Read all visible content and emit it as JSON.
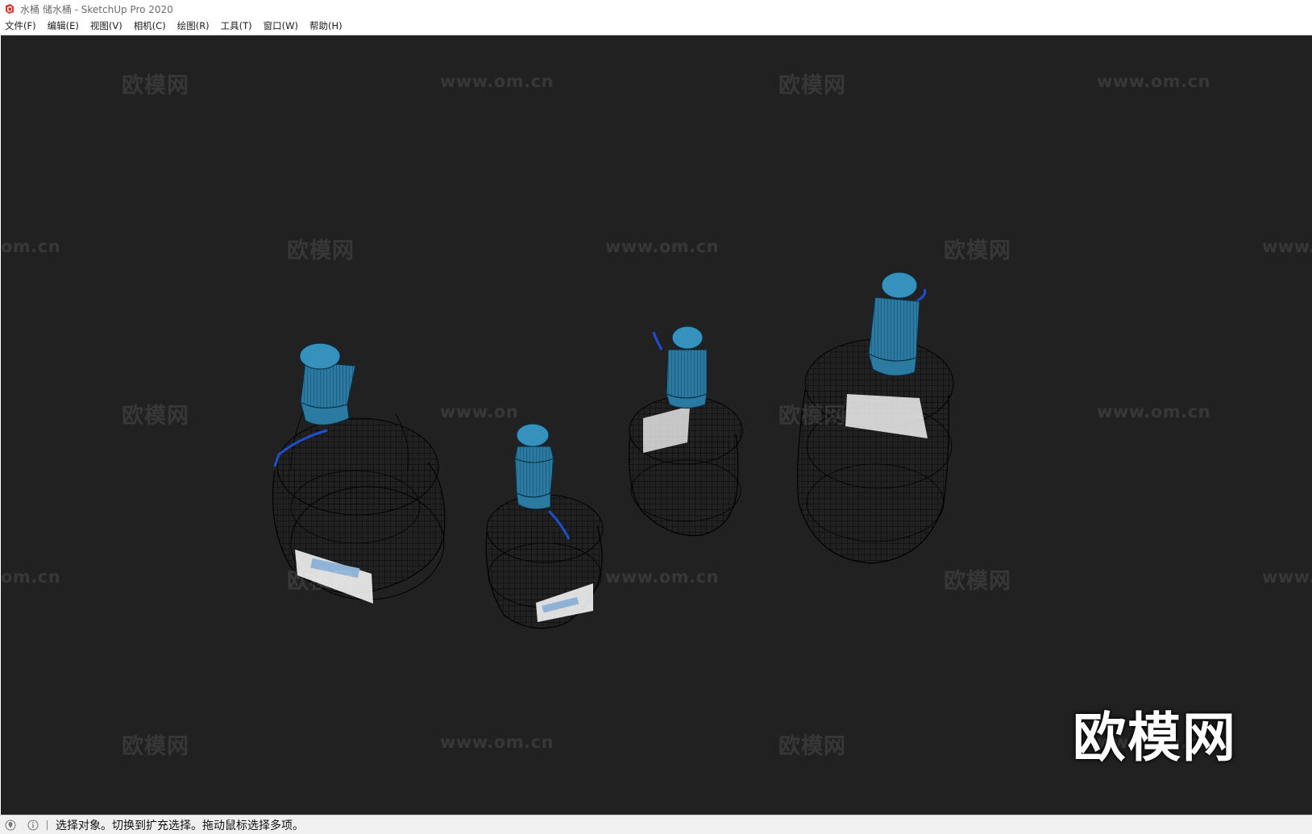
{
  "window": {
    "title": "水桶 储水桶 - SketchUp Pro 2020"
  },
  "menu": {
    "items": [
      {
        "id": "file",
        "label": "文件(F)"
      },
      {
        "id": "edit",
        "label": "编辑(E)"
      },
      {
        "id": "view",
        "label": "视图(V)"
      },
      {
        "id": "camera",
        "label": "相机(C)"
      },
      {
        "id": "draw",
        "label": "绘图(R)"
      },
      {
        "id": "tools",
        "label": "工具(T)"
      },
      {
        "id": "window",
        "label": "窗口(W)"
      },
      {
        "id": "help",
        "label": "帮助(H)"
      }
    ]
  },
  "watermark": {
    "brand": "欧模网",
    "url": "www.om.cn",
    "url_fragment_left": "om.cn",
    "url_fragment_right": "www.",
    "url_fragment_mid": "www.on"
  },
  "status": {
    "message": "选择对象。切换到扩充选择。拖动鼠标选择多项。"
  },
  "colors": {
    "viewport_bg": "#212121",
    "wire": "#000000",
    "cap": "#2e7fa6",
    "cap_light": "#4aa3cc",
    "tube": "#1d4fd0",
    "label": "#ffffff"
  },
  "icons": {
    "app": "sketchup-icon",
    "geo": "geolocation-icon",
    "info": "info-icon"
  }
}
